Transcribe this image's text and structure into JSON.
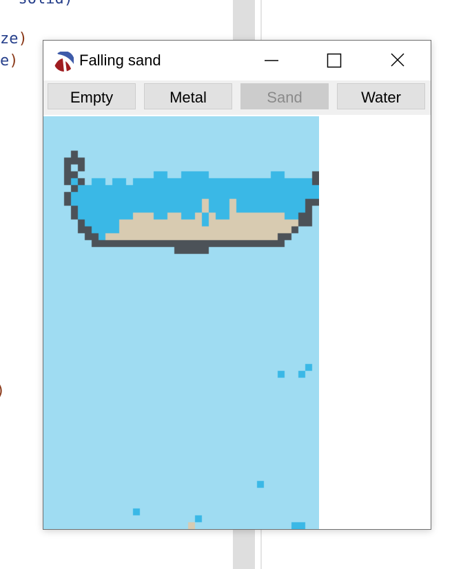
{
  "background_code": {
    "line1": "  solid)",
    "line2": "ze",
    "line3": "e"
  },
  "window": {
    "title": "Falling sand",
    "controls": {
      "minimize": "minimize-icon",
      "maximize": "maximize-icon",
      "close": "close-icon"
    }
  },
  "toolbar": {
    "buttons": [
      {
        "label": "Empty",
        "enabled": true
      },
      {
        "label": "Metal",
        "enabled": true
      },
      {
        "label": "Sand",
        "enabled": false
      },
      {
        "label": "Water",
        "enabled": true
      }
    ]
  },
  "simulation": {
    "grid_cols": 40,
    "grid_rows": 60,
    "colors": {
      "empty": "#9fdcf2",
      "metal": "#4c5258",
      "sand": "#d8cbb1",
      "water": "#3ab8e6",
      "window_bg": "#ffffff"
    }
  }
}
